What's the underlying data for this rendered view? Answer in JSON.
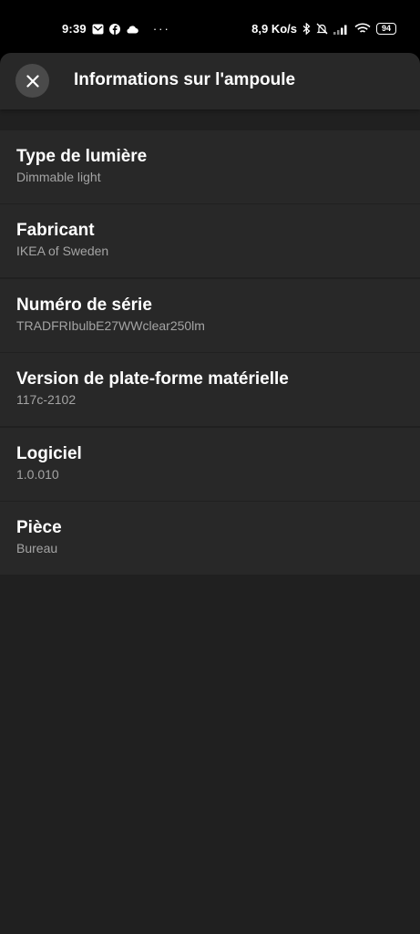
{
  "status_bar": {
    "time": "9:39",
    "dots": "···",
    "network_speed": "8,9 Ko/s",
    "battery": "94",
    "icons": [
      "mail-icon",
      "facebook-icon",
      "cloud-icon",
      "bluetooth-icon",
      "alarm-off-icon",
      "signal-icon",
      "wifi-icon",
      "battery-icon"
    ]
  },
  "header": {
    "title": "Informations sur l'ampoule",
    "close_icon": "close-icon"
  },
  "info": [
    {
      "label": "Type de lumière",
      "value": "Dimmable light"
    },
    {
      "label": "Fabricant",
      "value": "IKEA of Sweden"
    },
    {
      "label": "Numéro de série",
      "value": "TRADFRIbulbE27WWclear250lm"
    },
    {
      "label": "Version de plate-forme matérielle",
      "value": "117c-2102"
    },
    {
      "label": "Logiciel",
      "value": "1.0.010"
    },
    {
      "label": "Pièce",
      "value": "Bureau"
    }
  ],
  "colors": {
    "background": "#202020",
    "card": "#282828",
    "label": "#ffffff",
    "value": "#a4a4a4",
    "close_button": "#4a4a4a"
  }
}
